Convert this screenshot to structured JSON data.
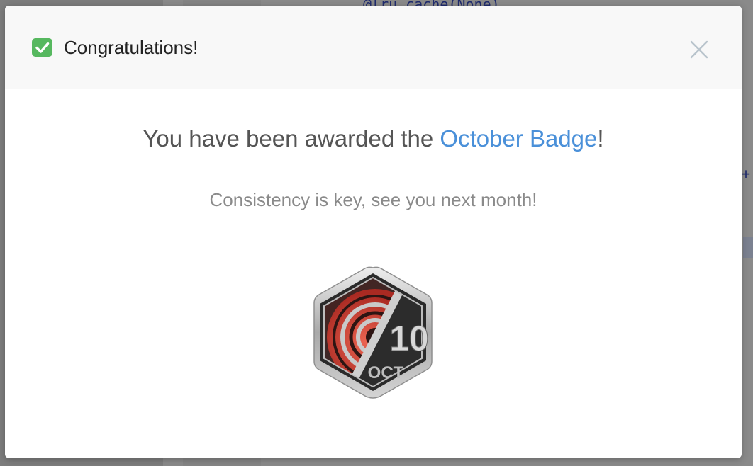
{
  "background": {
    "code_fragment": "@lru_cache(None)",
    "plus_glyph": "+"
  },
  "modal": {
    "title": "Congratulations!",
    "title_icon": "check-mark-button-icon",
    "close_icon": "close-icon",
    "headline_prefix": "You have been awarded the ",
    "badge_name": "October Badge",
    "headline_suffix": "!",
    "subtitle": "Consistency is key, see you next month!",
    "badge": {
      "icon": "october-badge-icon",
      "number": "10",
      "month": "OCT"
    }
  },
  "colors": {
    "accent_link": "#4a90d9",
    "check_green": "#56b85f",
    "badge_red": "#d9443b",
    "badge_dark": "#2b2b2b"
  }
}
